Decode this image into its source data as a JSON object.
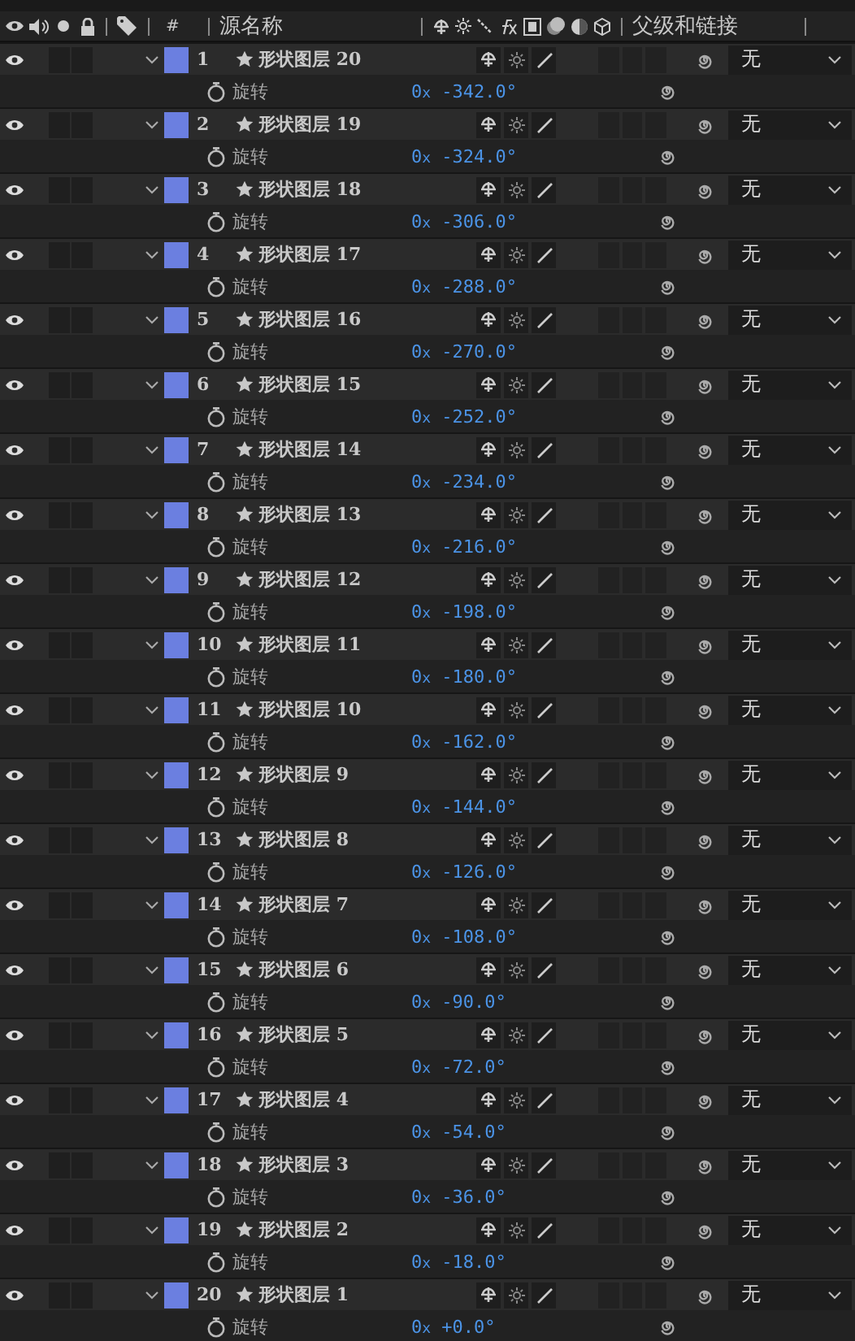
{
  "header": {
    "number_label": "#",
    "name_label": "源名称",
    "parent_label": "父级和链接"
  },
  "layers": [
    {
      "number": "1",
      "name": "形状图层 20",
      "visible": true,
      "color": "#6b7fe0",
      "expanded": true,
      "property": "旋转",
      "revolutions": "0x",
      "degrees": "-342.0°",
      "parent": "无"
    },
    {
      "number": "2",
      "name": "形状图层 19",
      "visible": true,
      "color": "#6b7fe0",
      "expanded": true,
      "property": "旋转",
      "revolutions": "0x",
      "degrees": "-324.0°",
      "parent": "无"
    },
    {
      "number": "3",
      "name": "形状图层 18",
      "visible": true,
      "color": "#6b7fe0",
      "expanded": true,
      "property": "旋转",
      "revolutions": "0x",
      "degrees": "-306.0°",
      "parent": "无"
    },
    {
      "number": "4",
      "name": "形状图层 17",
      "visible": true,
      "color": "#6b7fe0",
      "expanded": true,
      "property": "旋转",
      "revolutions": "0x",
      "degrees": "-288.0°",
      "parent": "无"
    },
    {
      "number": "5",
      "name": "形状图层 16",
      "visible": true,
      "color": "#6b7fe0",
      "expanded": true,
      "property": "旋转",
      "revolutions": "0x",
      "degrees": "-270.0°",
      "parent": "无"
    },
    {
      "number": "6",
      "name": "形状图层 15",
      "visible": true,
      "color": "#6b7fe0",
      "expanded": true,
      "property": "旋转",
      "revolutions": "0x",
      "degrees": "-252.0°",
      "parent": "无"
    },
    {
      "number": "7",
      "name": "形状图层 14",
      "visible": true,
      "color": "#6b7fe0",
      "expanded": true,
      "property": "旋转",
      "revolutions": "0x",
      "degrees": "-234.0°",
      "parent": "无"
    },
    {
      "number": "8",
      "name": "形状图层 13",
      "visible": true,
      "color": "#6b7fe0",
      "expanded": true,
      "property": "旋转",
      "revolutions": "0x",
      "degrees": "-216.0°",
      "parent": "无"
    },
    {
      "number": "9",
      "name": "形状图层 12",
      "visible": true,
      "color": "#6b7fe0",
      "expanded": true,
      "property": "旋转",
      "revolutions": "0x",
      "degrees": "-198.0°",
      "parent": "无"
    },
    {
      "number": "10",
      "name": "形状图层 11",
      "visible": true,
      "color": "#6b7fe0",
      "expanded": true,
      "property": "旋转",
      "revolutions": "0x",
      "degrees": "-180.0°",
      "parent": "无"
    },
    {
      "number": "11",
      "name": "形状图层 10",
      "visible": true,
      "color": "#6b7fe0",
      "expanded": true,
      "property": "旋转",
      "revolutions": "0x",
      "degrees": "-162.0°",
      "parent": "无"
    },
    {
      "number": "12",
      "name": "形状图层 9",
      "visible": true,
      "color": "#6b7fe0",
      "expanded": true,
      "property": "旋转",
      "revolutions": "0x",
      "degrees": "-144.0°",
      "parent": "无"
    },
    {
      "number": "13",
      "name": "形状图层 8",
      "visible": true,
      "color": "#6b7fe0",
      "expanded": true,
      "property": "旋转",
      "revolutions": "0x",
      "degrees": "-126.0°",
      "parent": "无"
    },
    {
      "number": "14",
      "name": "形状图层 7",
      "visible": true,
      "color": "#6b7fe0",
      "expanded": true,
      "property": "旋转",
      "revolutions": "0x",
      "degrees": "-108.0°",
      "parent": "无"
    },
    {
      "number": "15",
      "name": "形状图层 6",
      "visible": true,
      "color": "#6b7fe0",
      "expanded": true,
      "property": "旋转",
      "revolutions": "0x",
      "degrees": "-90.0°",
      "parent": "无"
    },
    {
      "number": "16",
      "name": "形状图层 5",
      "visible": true,
      "color": "#6b7fe0",
      "expanded": true,
      "property": "旋转",
      "revolutions": "0x",
      "degrees": "-72.0°",
      "parent": "无"
    },
    {
      "number": "17",
      "name": "形状图层 4",
      "visible": true,
      "color": "#6b7fe0",
      "expanded": true,
      "property": "旋转",
      "revolutions": "0x",
      "degrees": "-54.0°",
      "parent": "无"
    },
    {
      "number": "18",
      "name": "形状图层 3",
      "visible": true,
      "color": "#6b7fe0",
      "expanded": true,
      "property": "旋转",
      "revolutions": "0x",
      "degrees": "-36.0°",
      "parent": "无"
    },
    {
      "number": "19",
      "name": "形状图层 2",
      "visible": true,
      "color": "#6b7fe0",
      "expanded": true,
      "property": "旋转",
      "revolutions": "0x",
      "degrees": "-18.0°",
      "parent": "无"
    },
    {
      "number": "20",
      "name": "形状图层 1",
      "visible": true,
      "color": "#6b7fe0",
      "expanded": true,
      "property": "旋转",
      "revolutions": "0x",
      "degrees": "+0.0°",
      "parent": "无"
    }
  ]
}
